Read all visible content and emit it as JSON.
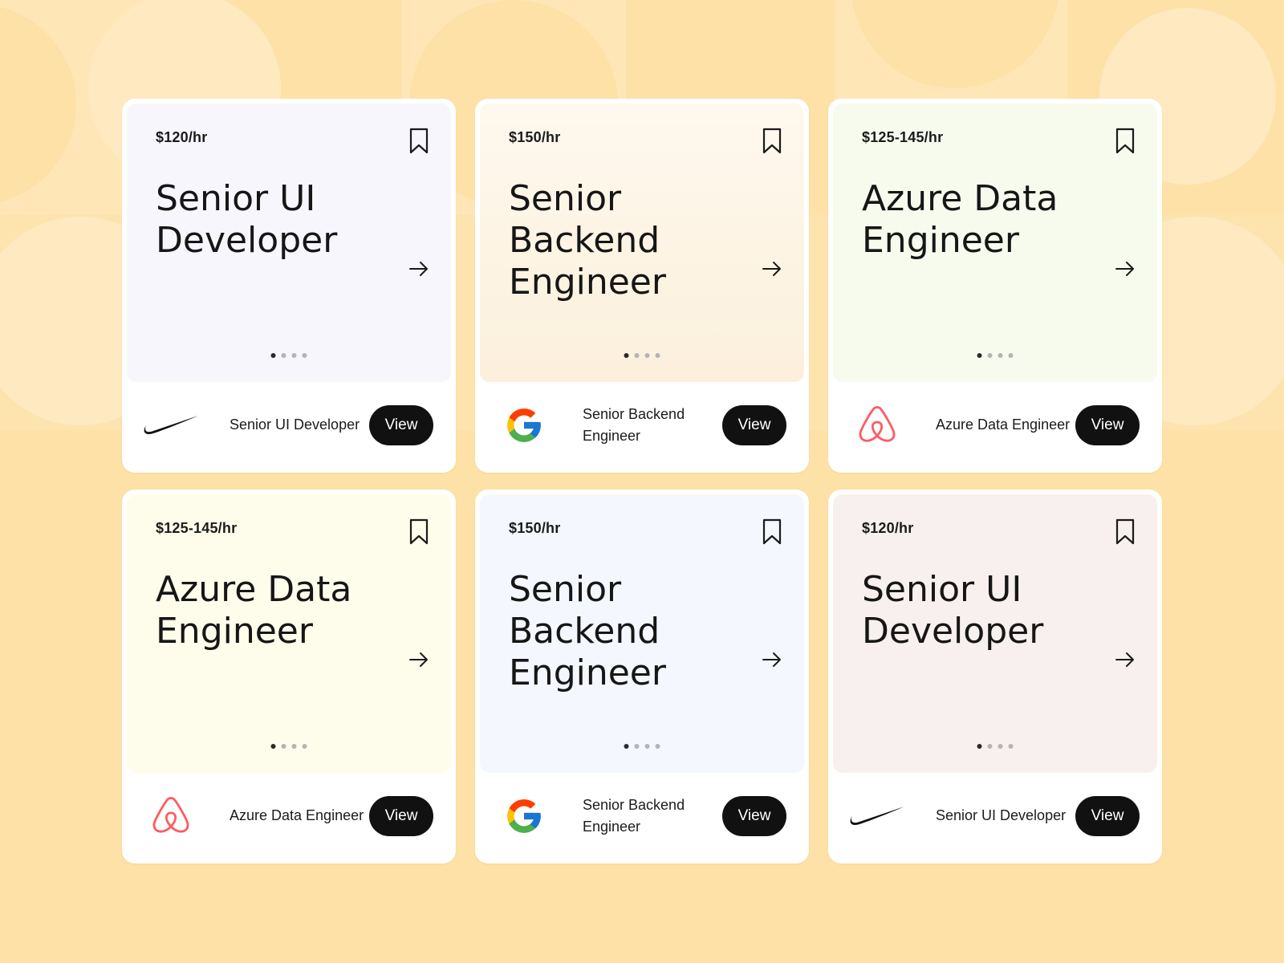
{
  "colors": {
    "background": "#fde1a7",
    "button": "#111111",
    "airbnb": "#ff5a5f"
  },
  "cards": [
    {
      "rate": "$120/hr",
      "title": "Senior UI Developer",
      "company_logo": "nike-logo",
      "footer_title": "Senior UI Developer",
      "button_label": "View",
      "bookmark_icon": "bookmark-icon",
      "arrow_icon": "arrow-right-icon",
      "carousel": {
        "total": 4,
        "active": 1
      }
    },
    {
      "rate": "$150/hr",
      "title": "Senior Backend Engineer",
      "company_logo": "google-logo",
      "footer_title": "Senior Backend Engineer",
      "button_label": "View",
      "bookmark_icon": "bookmark-icon",
      "arrow_icon": "arrow-right-icon",
      "carousel": {
        "total": 4,
        "active": 1
      }
    },
    {
      "rate": "$125-145/hr",
      "title": "Azure Data Engineer",
      "company_logo": "airbnb-logo",
      "footer_title": "Azure Data Engineer",
      "button_label": "View",
      "bookmark_icon": "bookmark-icon",
      "arrow_icon": "arrow-right-icon",
      "carousel": {
        "total": 4,
        "active": 1
      }
    },
    {
      "rate": "$125-145/hr",
      "title": "Azure Data Engineer",
      "company_logo": "airbnb-logo",
      "footer_title": "Azure Data Engineer",
      "button_label": "View",
      "bookmark_icon": "bookmark-icon",
      "arrow_icon": "arrow-right-icon",
      "carousel": {
        "total": 4,
        "active": 1
      }
    },
    {
      "rate": "$150/hr",
      "title": "Senior Backend Engineer",
      "company_logo": "google-logo",
      "footer_title": "Senior Backend Engineer",
      "button_label": "View",
      "bookmark_icon": "bookmark-icon",
      "arrow_icon": "arrow-right-icon",
      "carousel": {
        "total": 4,
        "active": 1
      }
    },
    {
      "rate": "$120/hr",
      "title": "Senior UI Developer",
      "company_logo": "nike-logo",
      "footer_title": "Senior UI Developer",
      "button_label": "View",
      "bookmark_icon": "bookmark-icon",
      "arrow_icon": "arrow-right-icon",
      "carousel": {
        "total": 4,
        "active": 1
      }
    }
  ]
}
